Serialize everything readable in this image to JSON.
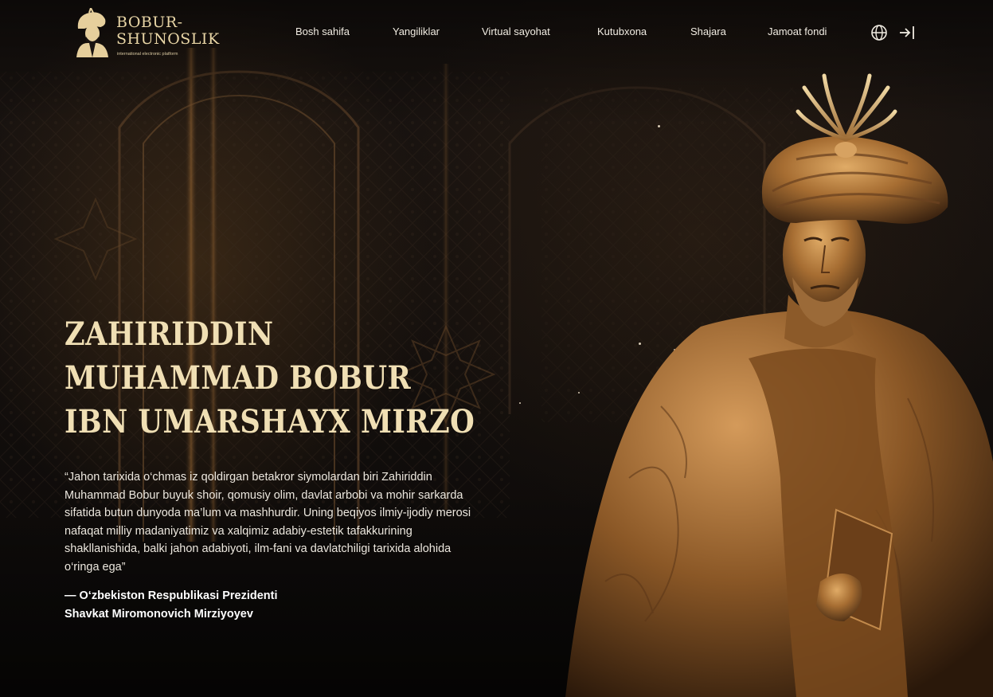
{
  "brand": {
    "title_line1": "BOBUR-",
    "title_line2": "SHUNOSLIK",
    "subtitle": "international electronic platform"
  },
  "nav": {
    "items": [
      {
        "label": "Bosh sahifa"
      },
      {
        "label": "Yangiliklar"
      },
      {
        "label": "Virtual sayohat"
      },
      {
        "label": "Kutubxona"
      },
      {
        "label": "Shajara"
      },
      {
        "label": "Jamoat fondi"
      }
    ],
    "language_icon": "globe-icon",
    "login_icon": "login-arrow-icon"
  },
  "hero": {
    "title_lines": [
      "ZAHIRIDDIN",
      "MUHAMMAD BOBUR",
      "IBN UMARSHAYX MIRZO"
    ],
    "quote": "“Jahon tarixida o‘chmas iz qoldirgan betakror siymolardan biri Zahiriddin Muhammad Bobur buyuk shoir, qomusiy olim, davlat arbobi va mohir sarkarda sifatida butun dunyoda ma’lum va mashhurdir. Uning beqiyos ilmiy-ijodiy merosi nafaqat milliy madaniyatimiz va xalqimiz adabiy-estetik tafakkurining shakllanishida, balki jahon adabiyoti, ilm-fani va davlatchiligi tarixida alohida o‘ringa ega”",
    "attribution_line1": "— O‘zbekiston Respublikasi Prezidenti",
    "attribution_line2": "Shavkat Miromonovich Mirziyoyev"
  },
  "colors": {
    "background": "#120e0c",
    "title_gold": "#f0dfb4",
    "logo_gold": "#e9d6a6",
    "bronze": "#b0793d"
  }
}
